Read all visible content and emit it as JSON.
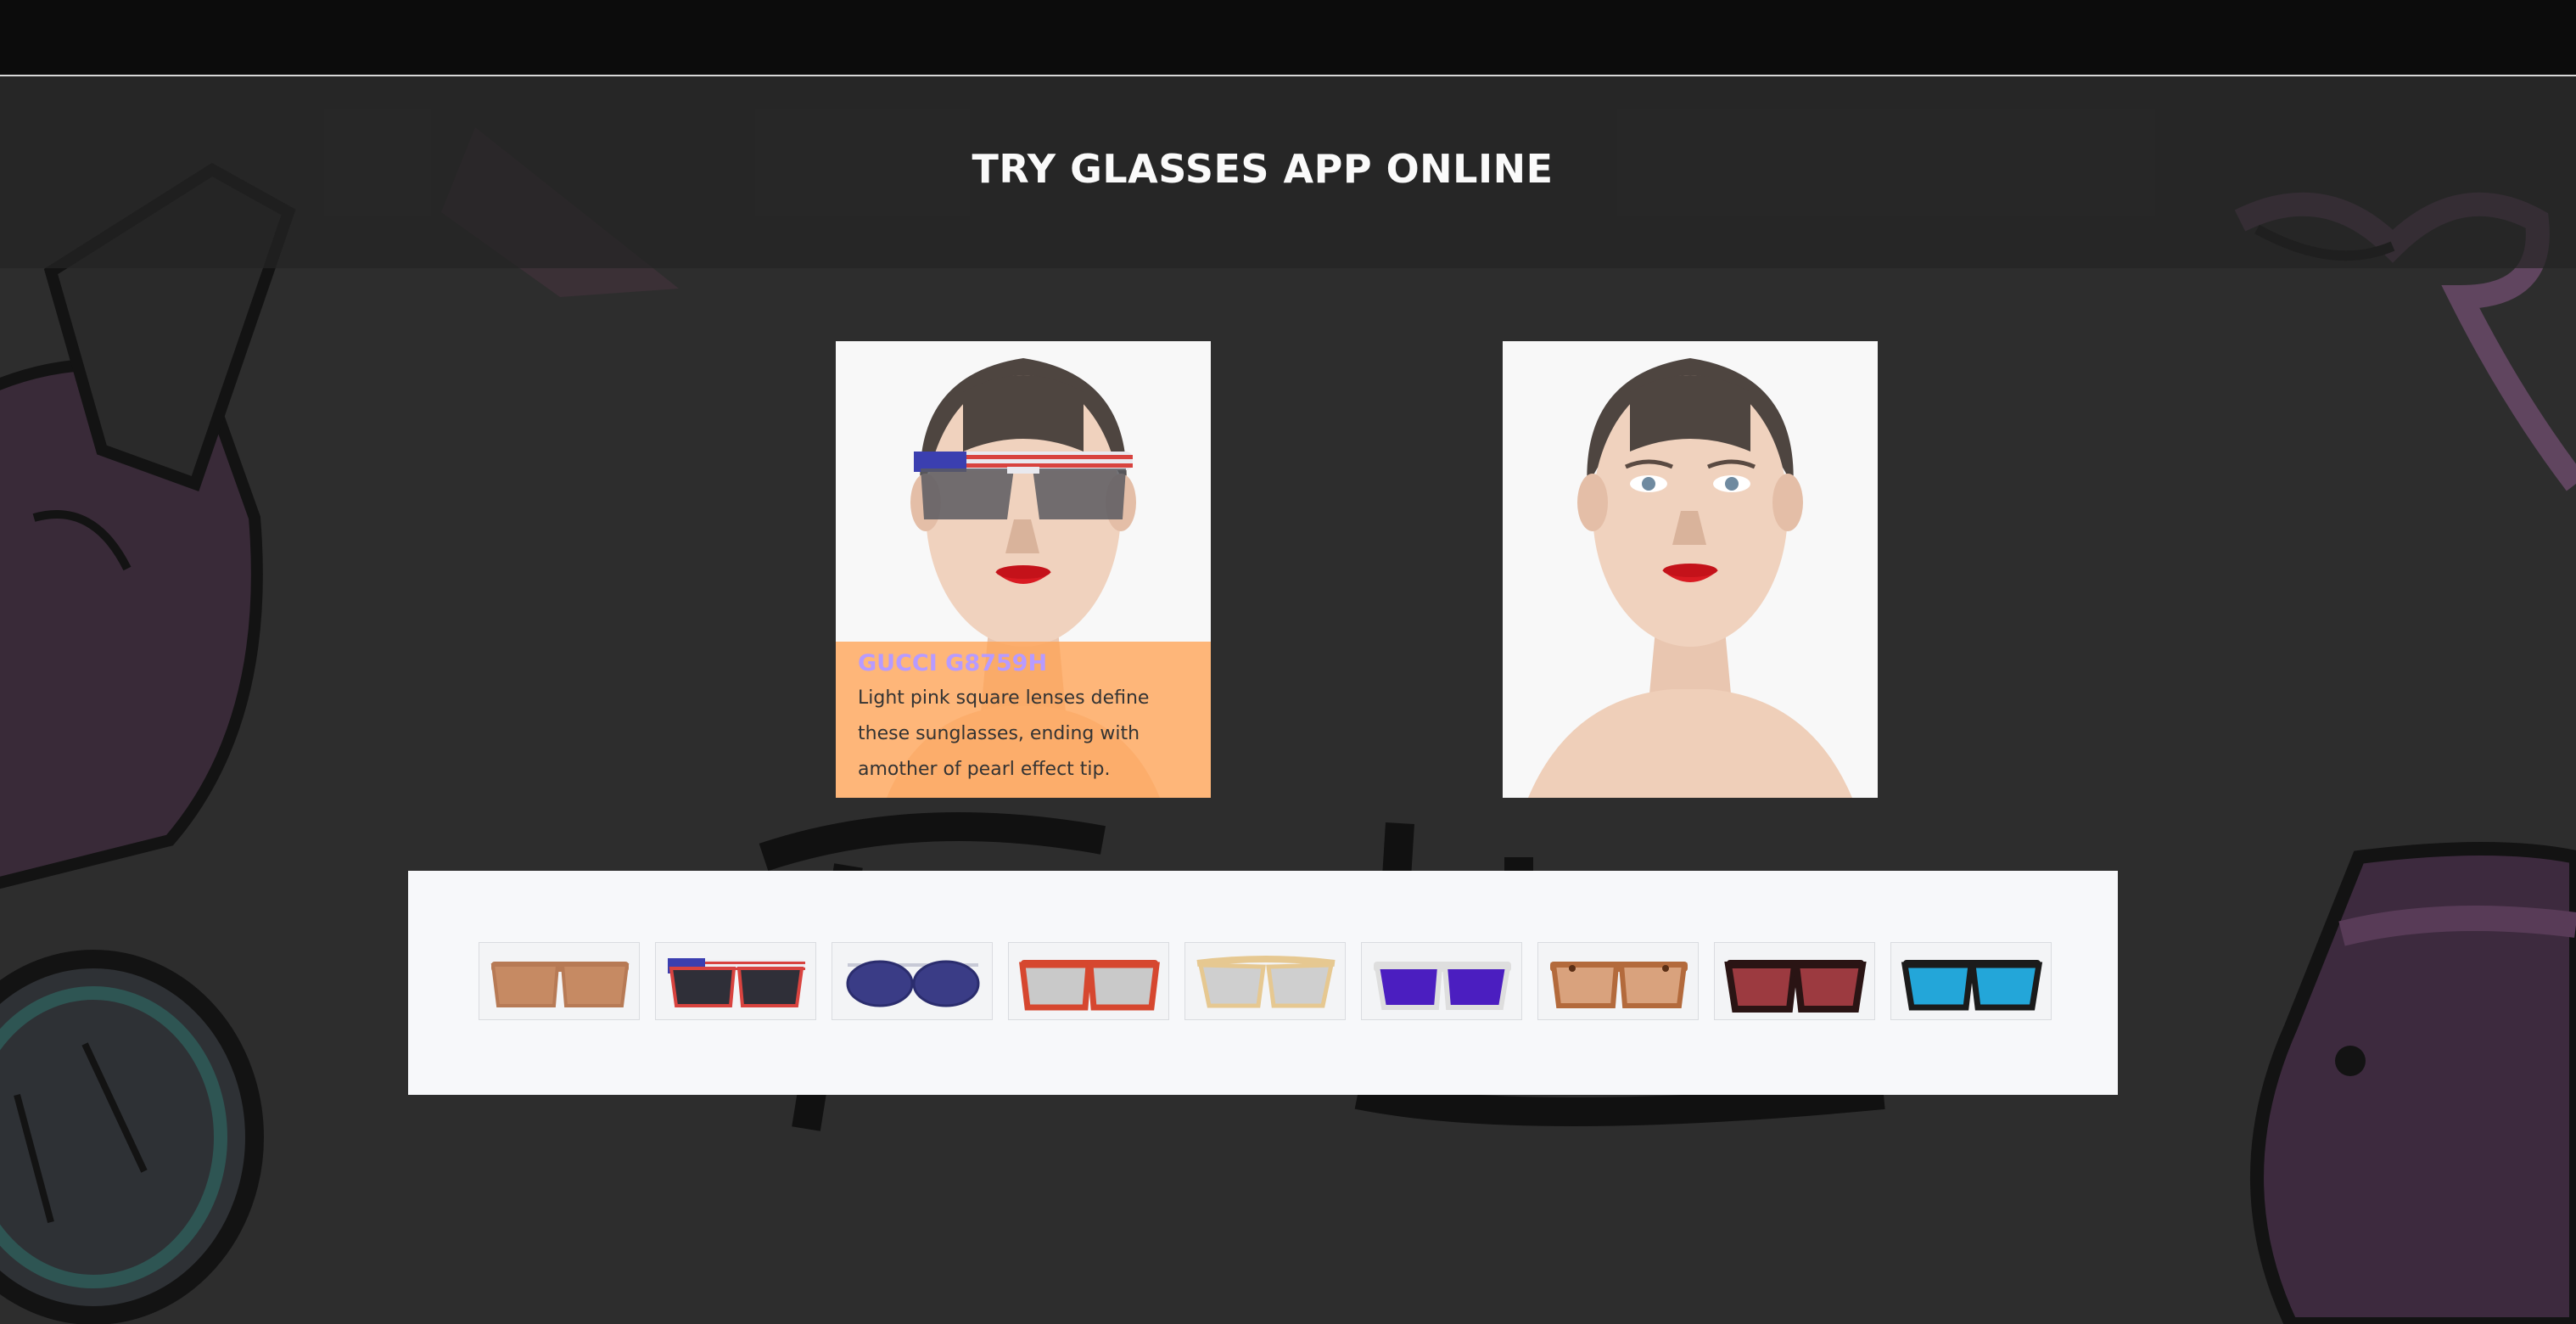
{
  "app": {
    "title": "TRY GLASSES APP ONLINE"
  },
  "model_preview": {
    "selected_product": {
      "name": "GUCCI G8759H",
      "description": "Light pink square lenses define these sunglasses, ending with amother of pearl effect tip."
    },
    "applied_glasses_icon": "usa-flag-sunglasses-icon"
  },
  "original_photo": {
    "icon": "woman-portrait-icon"
  },
  "glasses_list": [
    {
      "icon": "brown-wayfarer-icon",
      "frame_color": "#b77a55",
      "lens_color": "#c68a63"
    },
    {
      "icon": "usa-flag-sunglasses-icon",
      "frame_color": "#d8433f",
      "lens_color": "#2f2f38"
    },
    {
      "icon": "navy-aviator-icon",
      "frame_color": "#2b2d6e",
      "lens_color": "#3a3c86"
    },
    {
      "icon": "red-wayfarer-icon",
      "frame_color": "#d6472f",
      "lens_color": "#c9c9c9"
    },
    {
      "icon": "gold-cat-eye-icon",
      "frame_color": "#e6c891",
      "lens_color": "#cfcfcf"
    },
    {
      "icon": "purple-lens-icon",
      "frame_color": "#dedede",
      "lens_color": "#4b1ec0"
    },
    {
      "icon": "tortoise-shell-icon",
      "frame_color": "#b36a3c",
      "lens_color": "#d9a27d"
    },
    {
      "icon": "dark-red-mirror-icon",
      "frame_color": "#2a1414",
      "lens_color": "#9c3a40"
    },
    {
      "icon": "blue-lens-wayfarer-icon",
      "frame_color": "#1b1b1b",
      "lens_color": "#23a6d9"
    }
  ],
  "colors": {
    "accent_panel": "#ffa354",
    "product_name": "#b79bff",
    "background": "#2d2d2d"
  }
}
